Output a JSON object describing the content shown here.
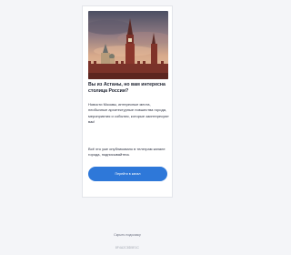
{
  "card": {
    "title": "Вы из Астаны, но вам интересна столица России?",
    "description": "Новости Москвы, интересные места, необычные архитектурные новшества города, мероприятия и события, которые заинтересуют вас!",
    "note": "Всё это уже опубликовано в телеграм канале города, подписывайтесь",
    "button_label": "Перейти в канал"
  },
  "footer": {
    "link_text": "Скрыть подсказку",
    "id_text": "8F4A2C8D5E1C"
  },
  "colors": {
    "accent": "#2e78d9",
    "background": "#f4f5f8",
    "card": "#ffffff"
  }
}
